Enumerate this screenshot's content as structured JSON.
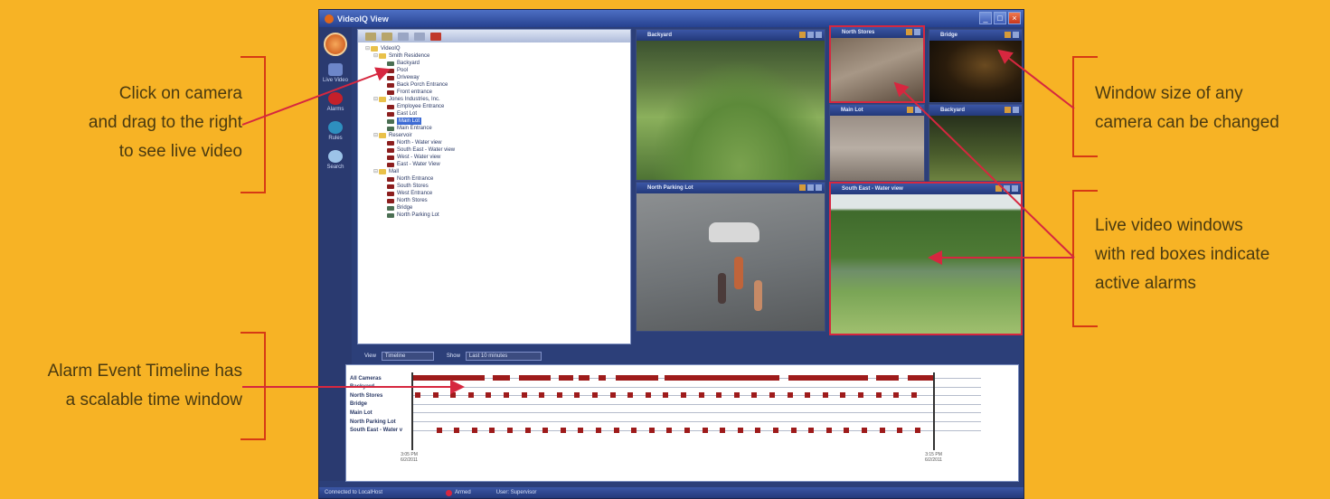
{
  "callouts": {
    "drag": {
      "lines": [
        "Click on camera",
        "and drag to the right",
        "to see live video"
      ]
    },
    "timeline": {
      "lines": [
        "Alarm Event Timeline has",
        "a scalable time window"
      ]
    },
    "resize": {
      "lines": [
        "Window size of any",
        "camera can be changed"
      ]
    },
    "alarms": {
      "lines": [
        "Live video windows",
        "with red boxes indicate",
        "active alarms"
      ]
    }
  },
  "app": {
    "title": "VideoIQ View",
    "nav": [
      "Live Video",
      "Alarms",
      "Rules",
      "Search"
    ],
    "tree": [
      {
        "label": "VideoIQ",
        "type": "folder",
        "level": 0
      },
      {
        "label": "Smith Residence",
        "type": "folder",
        "level": 1
      },
      {
        "label": "Backyard",
        "type": "cam-ok",
        "level": 2
      },
      {
        "label": "Pool",
        "type": "cam",
        "level": 2
      },
      {
        "label": "Driveway",
        "type": "cam",
        "level": 2
      },
      {
        "label": "Back Porch Entrance",
        "type": "cam",
        "level": 2
      },
      {
        "label": "Front entrance",
        "type": "cam",
        "level": 2
      },
      {
        "label": "Jones Industries, Inc.",
        "type": "folder",
        "level": 1
      },
      {
        "label": "Employee Entrance",
        "type": "cam",
        "level": 2
      },
      {
        "label": "East Lot",
        "type": "cam",
        "level": 2
      },
      {
        "label": "Main Lot",
        "type": "cam-ok",
        "level": 2,
        "selected": true
      },
      {
        "label": "Main Entrance",
        "type": "cam-ok",
        "level": 2
      },
      {
        "label": "Reservoir",
        "type": "folder",
        "level": 1
      },
      {
        "label": "North - Water view",
        "type": "cam",
        "level": 2
      },
      {
        "label": "South East - Water view",
        "type": "cam",
        "level": 2
      },
      {
        "label": "West - Water view",
        "type": "cam",
        "level": 2
      },
      {
        "label": "East - Water View",
        "type": "cam",
        "level": 2
      },
      {
        "label": "Mall",
        "type": "folder",
        "level": 1
      },
      {
        "label": "North Entrance",
        "type": "cam",
        "level": 2
      },
      {
        "label": "South Stores",
        "type": "cam",
        "level": 2
      },
      {
        "label": "West Entrance",
        "type": "cam",
        "level": 2
      },
      {
        "label": "North Stores",
        "type": "cam",
        "level": 2
      },
      {
        "label": "Bridge",
        "type": "cam-ok",
        "level": 2
      },
      {
        "label": "North Parking Lot",
        "type": "cam-ok",
        "level": 2
      }
    ],
    "videos": {
      "backyard_large": "Backyard",
      "north_stores": "North Stores",
      "bridge": "Bridge",
      "main_lot": "Main Lot",
      "backyard_small": "Backyard",
      "north_parking": "North Parking Lot",
      "south_east": "South East - Water view"
    },
    "filter": {
      "view_label": "View",
      "view_value": "Timeline",
      "show_label": "Show",
      "show_value": "Last 10 minutes"
    },
    "timeline_rows": [
      "All Cameras",
      "Backyard",
      "North Stores",
      "Bridge",
      "Main Lot",
      "North Parking Lot",
      "South East - Water v"
    ],
    "timeline_times": {
      "start": "3:05 PM\n6/2/2011",
      "end": "3:15 PM\n6/2/2011"
    },
    "status": {
      "connection": "Connected to LocalHost",
      "armed": "Armed",
      "user": "User: Supervisor"
    }
  }
}
